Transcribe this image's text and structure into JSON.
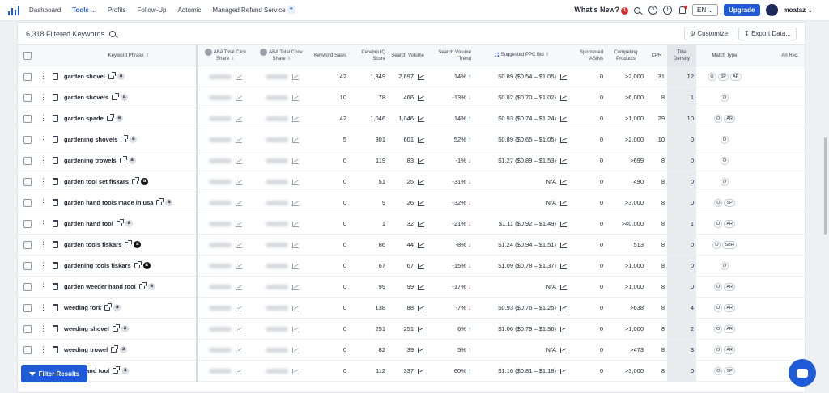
{
  "nav": {
    "items": [
      "Dashboard",
      "Tools",
      "Profits",
      "Follow-Up",
      "Adtomic",
      "Managed Refund Service"
    ],
    "whats_new": "What's New?",
    "whats_new_count": "1",
    "language": "EN",
    "upgrade": "Upgrade",
    "username": "moataz"
  },
  "toolbar": {
    "filtered_count": "6,318 Filtered Keywords",
    "customize": "Customize",
    "export": "Export Data..."
  },
  "columns": {
    "keyword": "Keyword Phrase",
    "aba_click": "ABA Total Click Share",
    "aba_conv": "ABA Total Conv. Share",
    "kw_sales": "Keyword Sales",
    "cerebro": "Cerebro IQ Score",
    "search_vol": "Search Volume",
    "trend": "Search Volume Trend",
    "ppc": "Suggested PPC Bid",
    "sponsored": "Sponsored ASINs",
    "competing": "Competing Products",
    "cpr": "CPR",
    "density": "Title Density",
    "match": "Match Type",
    "extra": "An Rec."
  },
  "rows": [
    {
      "kw": "garden shovel",
      "amz": "light",
      "sales": "142",
      "iq": "1,349",
      "vol": "2,697",
      "trend": "14%",
      "dir": "up",
      "ppc": "$0.89",
      "range": "($0.54 – $1.05)",
      "sp": "0",
      "comp": ">2,000",
      "cpr": "31",
      "dens": "12",
      "match": [
        "O",
        "SP",
        "AR"
      ]
    },
    {
      "kw": "garden shovels",
      "amz": "light",
      "sales": "10",
      "iq": "78",
      "vol": "466",
      "trend": "-13%",
      "dir": "down",
      "ppc": "$0.82",
      "range": "($0.70 – $1.02)",
      "sp": "0",
      "comp": ">6,000",
      "cpr": "8",
      "dens": "1",
      "match": [
        "O"
      ]
    },
    {
      "kw": "garden spade",
      "amz": "light",
      "sales": "42",
      "iq": "1,046",
      "vol": "1,046",
      "trend": "14%",
      "dir": "up",
      "ppc": "$0.93",
      "range": "($0.74 – $1.24)",
      "sp": "0",
      "comp": ">1,000",
      "cpr": "29",
      "dens": "10",
      "match": [
        "O",
        "AR"
      ]
    },
    {
      "kw": "gardening shovels",
      "amz": "light",
      "sales": "5",
      "iq": "301",
      "vol": "601",
      "trend": "52%",
      "dir": "up",
      "ppc": "$0.89",
      "range": "($0.65 – $1.05)",
      "sp": "0",
      "comp": ">2,000",
      "cpr": "10",
      "dens": "0",
      "match": [
        "O"
      ]
    },
    {
      "kw": "gardening trowels",
      "amz": "light",
      "sales": "0",
      "iq": "119",
      "vol": "83",
      "trend": "-1%",
      "dir": "down",
      "ppc": "$1.27",
      "range": "($0.89 – $1.53)",
      "sp": "0",
      "comp": ">699",
      "cpr": "8",
      "dens": "0",
      "match": [
        "O"
      ]
    },
    {
      "kw": "garden tool set fiskars",
      "amz": "dark",
      "sales": "0",
      "iq": "51",
      "vol": "25",
      "trend": "-31%",
      "dir": "down",
      "ppc": "N/A",
      "range": "",
      "sp": "0",
      "comp": "490",
      "cpr": "8",
      "dens": "0",
      "match": [
        "O"
      ]
    },
    {
      "kw": "garden hand tools made in usa",
      "amz": "light",
      "sales": "0",
      "iq": "9",
      "vol": "26",
      "trend": "-32%",
      "dir": "down",
      "ppc": "N/A",
      "range": "",
      "sp": "0",
      "comp": ">3,000",
      "cpr": "8",
      "dens": "0",
      "match": [
        "O",
        "SP"
      ]
    },
    {
      "kw": "garden hand tool",
      "amz": "light",
      "sales": "0",
      "iq": "1",
      "vol": "32",
      "trend": "-21%",
      "dir": "down",
      "ppc": "$1.11",
      "range": "($0.92 – $1.49)",
      "sp": "0",
      "comp": ">40,000",
      "cpr": "8",
      "dens": "1",
      "match": [
        "O",
        "AR"
      ]
    },
    {
      "kw": "garden tools fiskars",
      "amz": "dark",
      "sales": "0",
      "iq": "86",
      "vol": "44",
      "trend": "-8%",
      "dir": "down",
      "ppc": "$1.24",
      "range": "($0.94 – $1.51)",
      "sp": "0",
      "comp": "513",
      "cpr": "8",
      "dens": "0",
      "match": [
        "O",
        "SBH"
      ]
    },
    {
      "kw": "gardening tools fiskars",
      "amz": "dark",
      "sales": "0",
      "iq": "67",
      "vol": "67",
      "trend": "-15%",
      "dir": "down",
      "ppc": "$1.09",
      "range": "($0.78 – $1.37)",
      "sp": "0",
      "comp": ">1,000",
      "cpr": "8",
      "dens": "0",
      "match": [
        "O"
      ]
    },
    {
      "kw": "garden weeder hand tool",
      "amz": "light",
      "sales": "0",
      "iq": "99",
      "vol": "99",
      "trend": "-17%",
      "dir": "down",
      "ppc": "N/A",
      "range": "",
      "sp": "0",
      "comp": ">1,000",
      "cpr": "8",
      "dens": "0",
      "match": [
        "O",
        "AR"
      ]
    },
    {
      "kw": "weeding fork",
      "amz": "light",
      "sales": "0",
      "iq": "138",
      "vol": "88",
      "trend": "-7%",
      "dir": "down",
      "ppc": "$0.93",
      "range": "($0.76 – $1.25)",
      "sp": "0",
      "comp": ">638",
      "cpr": "8",
      "dens": "4",
      "match": [
        "O",
        "AR"
      ]
    },
    {
      "kw": "weeding shovel",
      "amz": "light",
      "sales": "0",
      "iq": "251",
      "vol": "251",
      "trend": "6%",
      "dir": "up",
      "ppc": "$1.06",
      "range": "($0.79 – $1.36)",
      "sp": "0",
      "comp": ">1,000",
      "cpr": "8",
      "dens": "2",
      "match": [
        "O",
        "AR"
      ]
    },
    {
      "kw": "weeding trowel",
      "amz": "light",
      "sales": "0",
      "iq": "82",
      "vol": "39",
      "trend": "5%",
      "dir": "up",
      "ppc": "N/A",
      "range": "",
      "sp": "0",
      "comp": ">473",
      "cpr": "8",
      "dens": "3",
      "match": [
        "O",
        "AR"
      ]
    },
    {
      "kw": "puller hand tool",
      "amz": "light",
      "sales": "0",
      "iq": "112",
      "vol": "337",
      "trend": "60%",
      "dir": "up",
      "ppc": "$1.16",
      "range": "($0.81 – $1.18)",
      "sp": "0",
      "comp": ">3,000",
      "cpr": "8",
      "dens": "0",
      "match": [
        "O",
        "SP"
      ]
    }
  ],
  "filter_button": "Filter Results"
}
